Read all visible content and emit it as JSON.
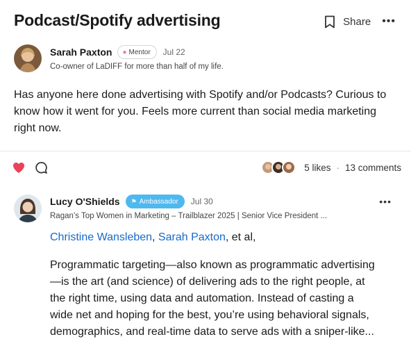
{
  "post": {
    "title": "Podcast/Spotify advertising",
    "share_label": "Share",
    "more_label": "•••",
    "author": {
      "name": "Sarah Paxton",
      "badge": "Mentor",
      "date": "Jul 22",
      "bio": "Co-owner of LaDIFF for more than half of my life."
    },
    "body": "Has anyone here done advertising with Spotify and/or Podcasts? Curious to know how it went for you. Feels more current than social media marketing right now.",
    "likes": "5 likes",
    "comments": "13 comments",
    "separator": "·"
  },
  "comment": {
    "name": "Lucy O'Shields",
    "badge": "Ambassador",
    "date": "Jul 30",
    "more_label": "•••",
    "headline": "Ragan’s Top Women in Marketing – Trailblazer 2025 | Senior Vice President ...",
    "mention_1": "Christine Wansleben",
    "mention_sep": ", ",
    "mention_2": "Sarah Paxton",
    "mention_tail": ", et al,",
    "body": "Programmatic targeting—also known as programmatic advertising—is the art (and science) of delivering ads to the right people, at the right time, using data and automation. Instead of casting a wide net and hoping for the best, you’re using behavioral signals, demographics, and real-time data to serve ads with a sniper-like..."
  },
  "colors": {
    "heart": "#e8435a",
    "link": "#1769c9",
    "ambassador_badge": "#4fb8ef"
  },
  "icons": [
    "bookmark-icon",
    "more-icon",
    "heart-icon",
    "comment-icon",
    "brain-icon",
    "flag-icon"
  ]
}
